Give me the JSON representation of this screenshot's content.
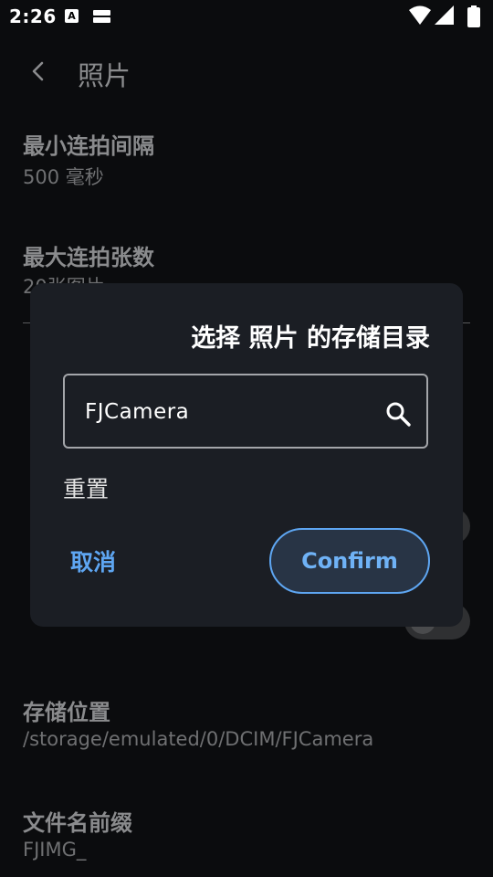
{
  "status_bar": {
    "time": "2:26",
    "a_badge": "A"
  },
  "app_bar": {
    "title": "照片"
  },
  "prefs": {
    "min_interval_title": "最小连拍间隔",
    "min_interval_summary": "500 毫秒",
    "max_burst_title": "最大连拍张数",
    "max_burst_summary": "20张图片",
    "storage_title": "存储位置",
    "storage_summary": "/storage/emulated/0/DCIM/FJCamera",
    "prefix_title": "文件名前缀",
    "prefix_summary": "FJIMG_"
  },
  "dialog": {
    "title": "选择 照片 的存储目录",
    "directory_value": "FJCamera",
    "reset_label": "重置",
    "cancel_label": "取消",
    "confirm_label": "Confirm"
  },
  "colors": {
    "accent": "#5ea6f2",
    "dialog_bg": "#1b1e24",
    "screen_bg": "#0b0c0e"
  }
}
